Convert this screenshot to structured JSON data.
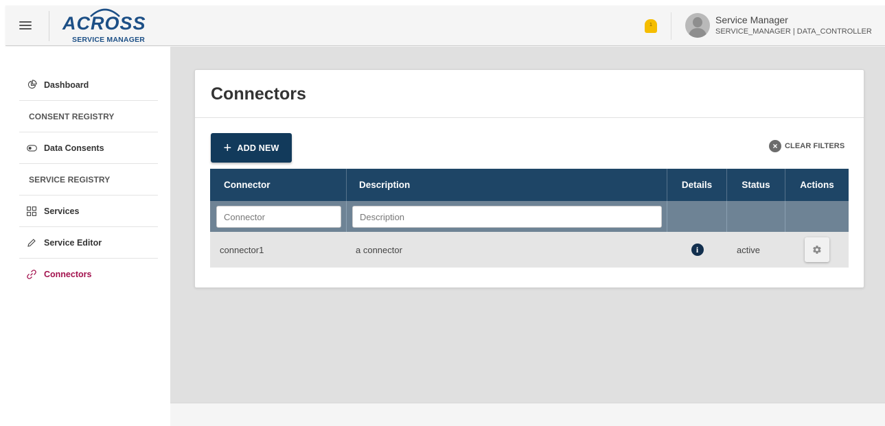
{
  "header": {
    "logo_text": "ACROSS",
    "logo_subtext": "SERVICE MANAGER",
    "notification_count": "1",
    "user_name": "Service Manager",
    "user_roles": "SERVICE_MANAGER | DATA_CONTROLLER",
    "icons": {
      "menu": "hamburger-icon",
      "notification": "bell-icon",
      "avatar": "user-avatar-icon"
    }
  },
  "sidebar": {
    "items": [
      {
        "label": "Dashboard",
        "icon": "pie-chart-icon",
        "type": "link"
      },
      {
        "label": "CONSENT REGISTRY",
        "type": "section"
      },
      {
        "label": "Data Consents",
        "icon": "toggle-icon",
        "type": "link"
      },
      {
        "label": "SERVICE REGISTRY",
        "type": "section"
      },
      {
        "label": "Services",
        "icon": "grid-icon",
        "type": "link"
      },
      {
        "label": "Service Editor",
        "icon": "pencil-icon",
        "type": "link"
      },
      {
        "label": "Connectors",
        "icon": "link-icon",
        "type": "link",
        "active": true
      }
    ],
    "active_color": "#a3124e"
  },
  "main": {
    "title": "Connectors",
    "add_button_label": "ADD NEW",
    "clear_filters_label": "CLEAR FILTERS",
    "table": {
      "columns": [
        "Connector",
        "Description",
        "Details",
        "Status",
        "Actions"
      ],
      "filters": {
        "connector_placeholder": "Connector",
        "description_placeholder": "Description"
      },
      "rows": [
        {
          "connector": "connector1",
          "description": "a connector",
          "details_icon": "info-icon",
          "status": "active",
          "action_icon": "gear-icon"
        }
      ]
    }
  },
  "colors": {
    "primary": "#123a5b",
    "table_header": "#1e4566",
    "filter_row": "#6e8395",
    "accent_active": "#a3124e",
    "notification": "#f5bd00"
  }
}
